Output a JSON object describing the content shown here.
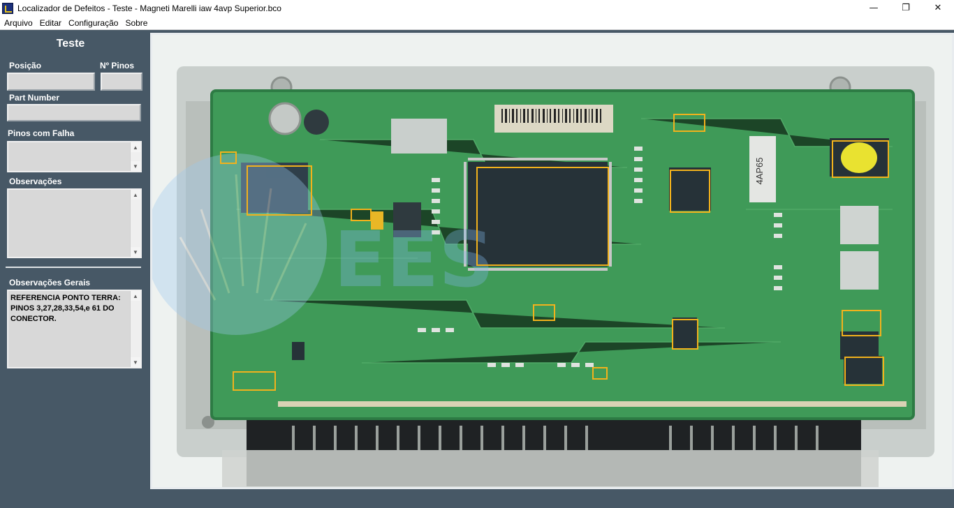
{
  "window": {
    "title": "Localizador de Defeitos - Teste - Magneti Marelli iaw 4avp Superior.bco",
    "controls": {
      "minimize": "—",
      "maximize": "❐",
      "close": "✕"
    }
  },
  "menu": [
    "Arquivo",
    "Editar",
    "Configuração",
    "Sobre"
  ],
  "panel": {
    "title": "Teste",
    "posicao_label": "Posição",
    "posicao_value": "",
    "npinos_label": "Nº Pinos",
    "npinos_value": "",
    "partnumber_label": "Part Number",
    "partnumber_value": "",
    "pinos_falha_label": "Pinos com Falha",
    "pinos_falha_value": "",
    "observacoes_label": "Observações",
    "observacoes_value": "",
    "observacoes_gerais_label": "Observações Gerais",
    "observacoes_gerais_value": "REFERENCIA PONTO TERRA: PINOS 3,27,28,33,54,e 61 DO CONECTOR."
  },
  "board": {
    "label_chip": "4AP65",
    "highlight_color": "#f2b21c",
    "board_color": "#3f9a58"
  }
}
